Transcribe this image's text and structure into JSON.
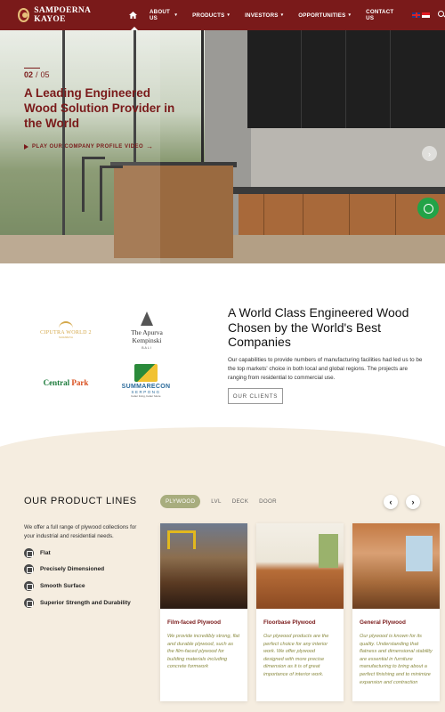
{
  "brand": {
    "name": "SAMPOERNA KAYOE"
  },
  "nav": {
    "items": [
      {
        "label": "ABOUT US",
        "caret": "▾"
      },
      {
        "label": "PRODUCTS",
        "caret": "▾"
      },
      {
        "label": "INVESTORS",
        "caret": "▾"
      },
      {
        "label": "OPPORTUNITIES",
        "caret": "▾"
      },
      {
        "label": "CONTACT US",
        "caret": ""
      }
    ],
    "languages": [
      "English",
      "Bahasa Indonesia"
    ]
  },
  "hero": {
    "slide_current": "02",
    "slide_separator": "/",
    "slide_total": "05",
    "title": "A Leading Engineered Wood Solution Provider in the World",
    "video_link": "PLAY OUR COMPANY PROFILE VIDEO",
    "slide_count": 5,
    "active_slide": 2
  },
  "clients": {
    "logos": {
      "ciputra": {
        "name": "CIPUTRA WORLD 2",
        "sub": "SURABAYA"
      },
      "apurva": {
        "name_1": "The Apurva",
        "name_2": "Kempinski",
        "sub": "BALI"
      },
      "central": {
        "name": "Central",
        "name_accent": "Park"
      },
      "summarecon": {
        "name": "SUMMARECON",
        "sub": "SERPONG",
        "tagline": "better living, better future"
      }
    },
    "title": "A World Class Engineered Wood Chosen by the World's Best Companies",
    "description": "Our capabilities to provide numbers of manufacturing facilities had led us to be the top markets' choice in both local and global regions. The projects are ranging from residential to commercial use.",
    "button": "OUR CLIENTS"
  },
  "products": {
    "title": "OUR PRODUCT LINES",
    "description": "We offer a full range of plywood collections for your industrial and residential needs.",
    "features": [
      "Flat",
      "Precisely Dimensioned",
      "Smooth Surface",
      "Superior Strength and Durability"
    ],
    "tabs": [
      "PLYWOOD",
      "LVL",
      "DECK",
      "DOOR"
    ],
    "active_tab": "PLYWOOD",
    "prev_label": "‹",
    "next_label": "›",
    "cards": [
      {
        "name": "Film-faced Plywood",
        "description": "We provide incredibly strong, flat and durable plywood, such as the film-faced plywood for building materials including concrete formwork"
      },
      {
        "name": "Floorbase Plywood",
        "description": "Our plywood products are the perfect choice for any interior work. We offer plywood designed with more precise dimension as it is of great importance of interior work."
      },
      {
        "name": "General Plywood",
        "description": "Our plywood is known for its quality. Understanding that flatness and dimensional stability are essential in furniture manufacturing to bring about a perfect finishing and to minimize expansion and contraction"
      }
    ]
  },
  "colors": {
    "brand_maroon": "#7a1a1a",
    "whatsapp_green": "#22a347",
    "cream": "#f5ede0",
    "tab_olive": "#a8ad7e"
  },
  "icons": [
    "logo-emblem",
    "home-icon",
    "uk-flag-icon",
    "indonesia-flag-icon",
    "search-icon",
    "play-icon",
    "chevron-right-icon",
    "whatsapp-icon",
    "feature-icon"
  ]
}
